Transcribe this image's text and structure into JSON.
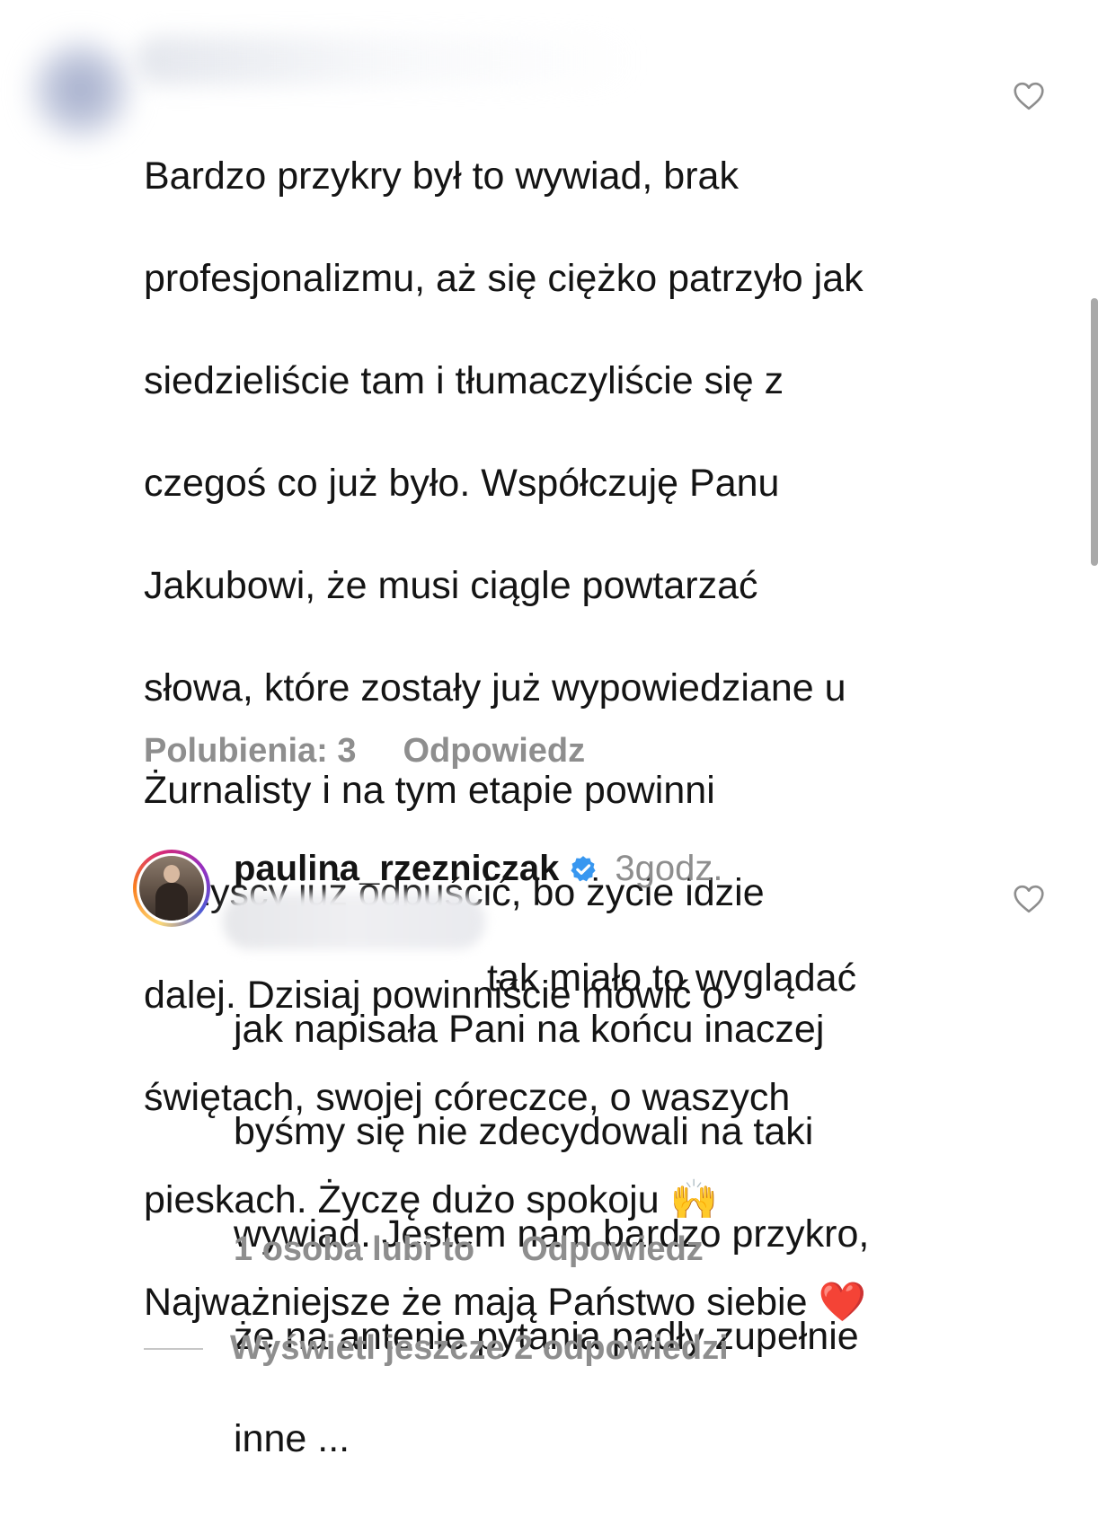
{
  "comment1": {
    "text_lines": [
      "Bardzo przykry był to wywiad, brak",
      "profesjonalizmu, aż się ciężko patrzyło jak",
      "siedzieliście tam i tłumaczyliście się z",
      "czegoś co już było. Współczuję Panu",
      "Jakubowi, że musi ciągle powtarzać",
      "słowa, które zostały już wypowiedziane u",
      "Żurnalisty i na tym etapie powinni",
      "wszyscy już odpuścić, bo życie idzie",
      "dalej. Dzisiaj powinniście mówić o",
      "świętach, swojej córeczce, o waszych",
      "pieskach. Życzę dużo spokoju 🙌",
      "Najważniejsze że mają Państwo siebie ❤️"
    ],
    "likes_label": "Polubienia: 3",
    "reply_label": "Odpowiedz",
    "like_icon": "heart-outline-icon"
  },
  "reply": {
    "username": "paulina_rzezniczak",
    "verified_icon": "verified-badge-icon",
    "verified_color": "#3897f0",
    "time": "3godz.",
    "text_lines": [
      "tak miało to wyglądać",
      "jak napisała Pani na końcu inaczej",
      "byśmy się nie zdecydowali na taki",
      "wywiad. Jestem nam bardzo przykro,",
      "że na antenie pytania padły zupełnie",
      "inne ..."
    ],
    "likes_label": "1 osoba lubi to",
    "reply_label": "Odpowiedz",
    "like_icon": "heart-outline-icon"
  },
  "view_more_label": "Wyświetl jeszcze 2 odpowiedzi",
  "colors": {
    "text": "#141414",
    "muted": "#8e8e8e"
  }
}
